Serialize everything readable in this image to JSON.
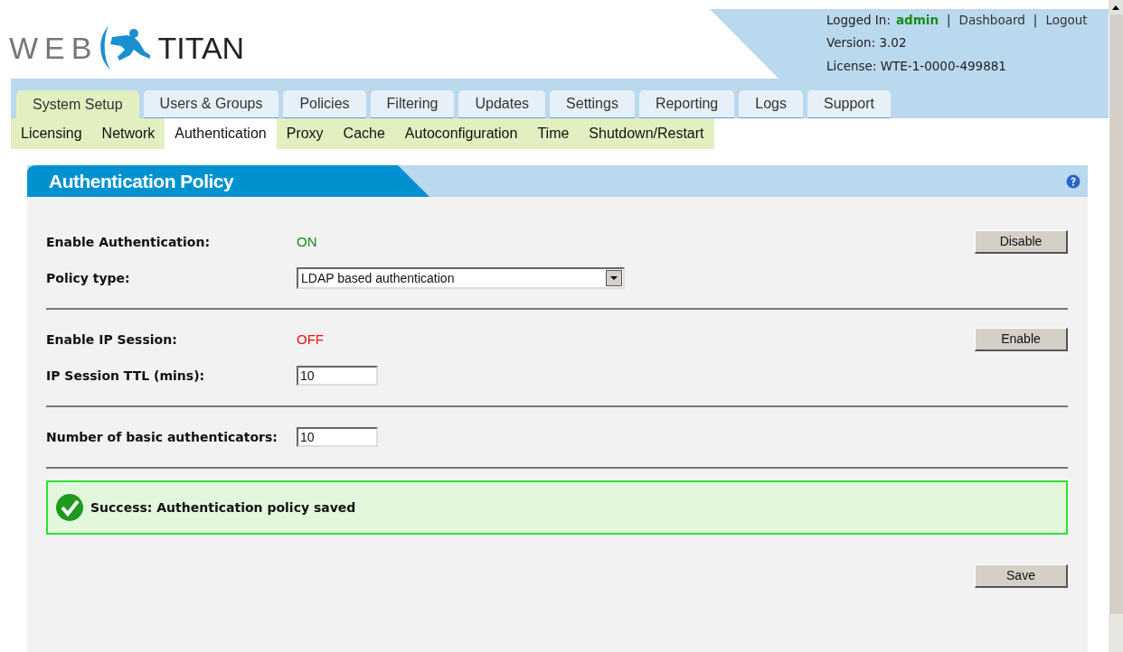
{
  "logo": {
    "left": "WEB",
    "right": "TITAN"
  },
  "account": {
    "label": "Logged In:",
    "user": "admin",
    "links": [
      {
        "separator": "|",
        "label": "Dashboard"
      },
      {
        "separator": "|",
        "label": "Logout"
      }
    ],
    "version": "Version: 3.02",
    "license": "License: WTE-1-0000-499881"
  },
  "tabs": [
    {
      "label": "System Setup",
      "selected": true
    },
    {
      "label": "Users & Groups",
      "selected": false
    },
    {
      "label": "Policies",
      "selected": false
    },
    {
      "label": "Filtering",
      "selected": false
    },
    {
      "label": "Updates",
      "selected": false
    },
    {
      "label": "Settings",
      "selected": false
    },
    {
      "label": "Reporting",
      "selected": false
    },
    {
      "label": "Logs",
      "selected": false
    },
    {
      "label": "Support",
      "selected": false
    }
  ],
  "subtabs": [
    {
      "label": "Licensing",
      "selected": false
    },
    {
      "label": "Network",
      "selected": false
    },
    {
      "label": "Authentication",
      "selected": true
    },
    {
      "label": "Proxy",
      "selected": false
    },
    {
      "label": "Cache",
      "selected": false
    },
    {
      "label": "Autoconfiguration",
      "selected": false
    },
    {
      "label": "Time",
      "selected": false
    },
    {
      "label": "Shutdown/Restart",
      "selected": false
    }
  ],
  "panel": {
    "title": "Authentication Policy",
    "sections": [
      [
        {
          "kind": "status",
          "label": "Enable Authentication:",
          "value": "ON",
          "on": true,
          "button": "Disable"
        },
        {
          "kind": "select",
          "label": "Policy type:",
          "value": "LDAP based authentication"
        }
      ],
      [
        {
          "kind": "status",
          "label": "Enable IP Session:",
          "value": "OFF",
          "on": false,
          "button": "Enable"
        },
        {
          "kind": "input",
          "label": "IP Session TTL (mins):",
          "value": "10"
        }
      ],
      [
        {
          "kind": "input",
          "label": "Number of basic authenticators:",
          "value": "10"
        }
      ]
    ],
    "message": {
      "kind": "success",
      "text": "Success: Authentication policy saved"
    },
    "save": "Save"
  }
}
